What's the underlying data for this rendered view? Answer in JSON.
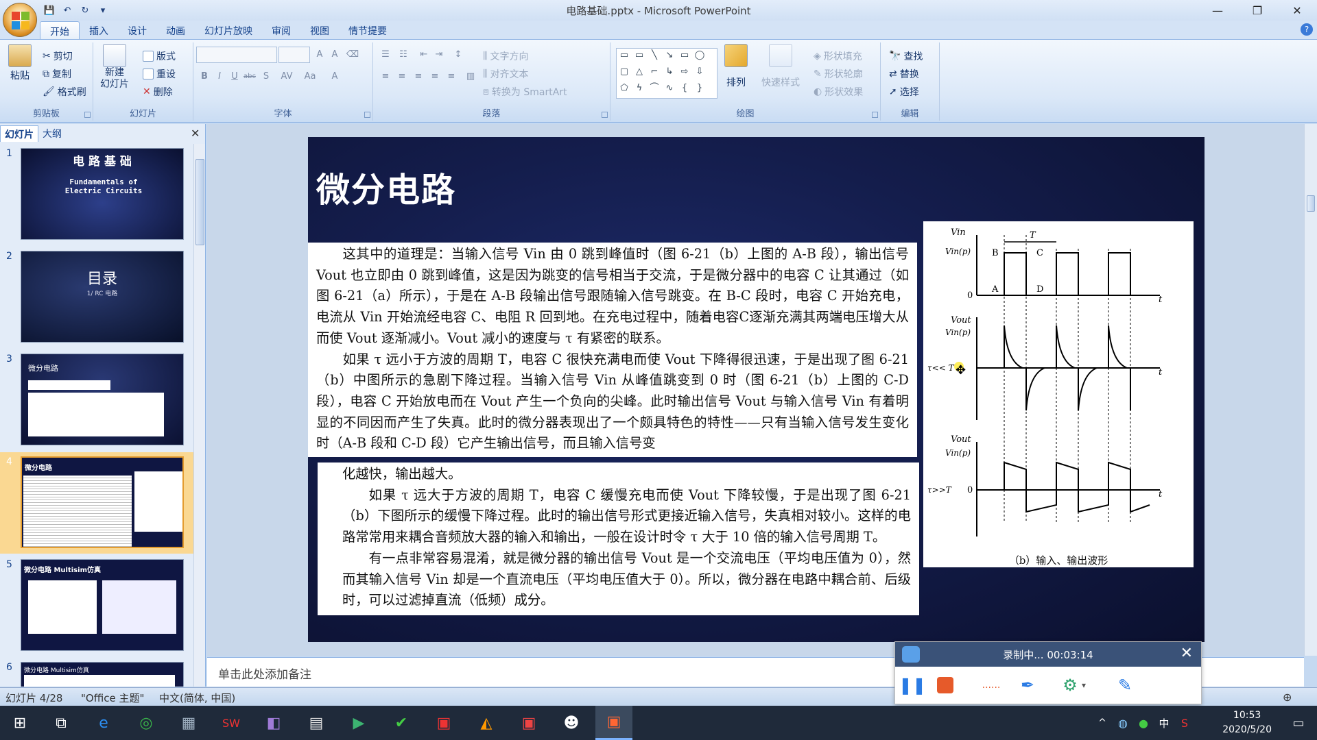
{
  "window": {
    "title": "电路基础.pptx - Microsoft PowerPoint",
    "minimize": "—",
    "restore": "❐",
    "close": "✕"
  },
  "qat": {
    "save_icon": "save-icon",
    "undo_icon": "undo-icon",
    "redo_icon": "redo-icon",
    "customize_icon": "dropdown-icon"
  },
  "tabs": [
    "开始",
    "插入",
    "设计",
    "动画",
    "幻灯片放映",
    "审阅",
    "视图",
    "情节提要"
  ],
  "ribbon": {
    "clipboard": {
      "label": "剪贴板",
      "paste": "粘贴",
      "cut": "剪切",
      "copy": "复制",
      "format_painter": "格式刷"
    },
    "slides": {
      "label": "幻灯片",
      "new_slide": "新建\n幻灯片",
      "layout": "版式",
      "reset": "重设",
      "delete": "删除"
    },
    "font": {
      "label": "字体",
      "bold": "B",
      "italic": "I",
      "underline": "U",
      "strike": "abc",
      "shadow": "S",
      "spacing": "AV",
      "case": "Aa",
      "color": "A"
    },
    "paragraph": {
      "label": "段落",
      "text_direction": "文字方向",
      "align_text": "对齐文本",
      "smartart": "转换为 SmartArt"
    },
    "drawing": {
      "label": "绘图",
      "arrange": "排列",
      "quick_styles": "快速样式",
      "shape_fill": "形状填充",
      "shape_outline": "形状轮廓",
      "shape_effects": "形状效果"
    },
    "editing": {
      "label": "编辑",
      "find": "查找",
      "replace": "替换",
      "select": "选择"
    }
  },
  "pane": {
    "tab_slides": "幻灯片",
    "tab_outline": "大纲",
    "close": "✕"
  },
  "thumbnails": [
    {
      "num": "1",
      "title": "电 路 基 础",
      "subtitle": "Fundamentals of Electric Circuits"
    },
    {
      "num": "2",
      "title": "目录",
      "subtitle": "1/ RC 电路"
    },
    {
      "num": "3",
      "title": "微分电路",
      "subtitle": ""
    },
    {
      "num": "4",
      "title": "微分电路",
      "subtitle": ""
    },
    {
      "num": "5",
      "title": "微分电路 Multisim仿真",
      "subtitle": ""
    },
    {
      "num": "6",
      "title": "微分电路 Multisim仿真",
      "subtitle": ""
    }
  ],
  "slide": {
    "title": "微分电路",
    "para1": "这其中的道理是：当输入信号 Vin 由 0 跳到峰值时（图 6-21（b）上图的 A-B 段），输出信号 Vout 也立即由 0 跳到峰值，这是因为跳变的信号相当于交流，于是微分器中的电容 C 让其通过（如图 6-21（a）所示），于是在 A-B 段输出信号跟随输入信号跳变。在 B-C 段时，电容 C 开始充电，电流从 Vin 开始流经电容 C、电阻 R 回到地。在充电过程中，随着电容C逐渐充满其两端电压增大从而使 Vout 逐渐减小。Vout 减小的速度与 τ 有紧密的联系。",
    "para2": "如果 τ 远小于方波的周期 T，电容 C 很快充满电而使 Vout 下降得很迅速，于是出现了图 6-21（b）中图所示的急剧下降过程。当输入信号 Vin 从峰值跳变到 0 时（图 6-21（b）上图的 C-D 段），电容 C 开始放电而在 Vout 产生一个负向的尖峰。此时输出信号 Vout 与输入信号 Vin 有着明显的不同因而产生了失真。此时的微分器表现出了一个颇具特色的特性——只有当输入信号发生变化时（A-B 段和 C-D 段）它产生输出信号，而且输入信号变",
    "para3": "化越快，输出越大。",
    "para4": "如果 τ 远大于方波的周期 T，电容 C 缓慢充电而使 Vout 下降较慢，于是出现了图 6-21（b）下图所示的缓慢下降过程。此时的输出信号形式更接近输入信号，失真相对较小。这样的电路常常用来耦合音频放大器的输入和输出，一般在设计时令 τ 大于 10 倍的输入信号周期 T。",
    "para5": "有一点非常容易混淆，就是微分器的输出信号 Vout 是一个交流电压（平均电压值为 0），然而其输入信号 Vin 却是一个直流电压（平均电压值大于 0）。所以，微分器在电路中耦合前、后级时，可以过滤掉直流（低频）成分。",
    "figure": {
      "caption": "（b）输入、输出波形",
      "vin": "Vin",
      "vinp": "Vin(p)",
      "vout": "Vout",
      "T": "T",
      "A": "A",
      "B": "B",
      "C": "C",
      "D": "D",
      "zero": "0",
      "t": "t",
      "tau_small": "τ<< T",
      "tau_large": "τ>>T"
    }
  },
  "notes": {
    "placeholder": "单击此处添加备注"
  },
  "status": {
    "slide": "幻灯片 4/28",
    "theme": "\"Office 主题\"",
    "lang": "中文(简体, 中国)"
  },
  "recorder": {
    "status": "录制中... 00:03:14",
    "close": "✕"
  },
  "taskbar": {
    "time": "10:53",
    "date": "2020/5/20",
    "ime": "中"
  }
}
